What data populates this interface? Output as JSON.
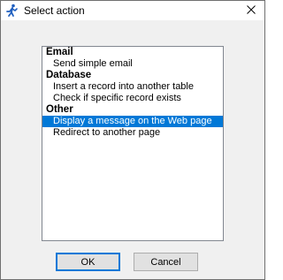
{
  "window": {
    "title": "Select action",
    "icon": "running-figure-icon"
  },
  "list": {
    "groups": [
      {
        "label": "Email",
        "items": [
          {
            "label": "Send simple email",
            "selected": false
          }
        ]
      },
      {
        "label": "Database",
        "items": [
          {
            "label": "Insert a record into another table",
            "selected": false
          },
          {
            "label": "Check if specific record exists",
            "selected": false
          }
        ]
      },
      {
        "label": "Other",
        "items": [
          {
            "label": "Display a message on the Web page",
            "selected": true
          },
          {
            "label": "Redirect to another page",
            "selected": false
          }
        ]
      }
    ]
  },
  "buttons": {
    "ok_label": "OK",
    "cancel_label": "Cancel"
  },
  "colors": {
    "selection": "#0078d7",
    "selection_text": "#ffffff",
    "dialog_bg": "#f0f0f0",
    "list_border": "#828790"
  }
}
